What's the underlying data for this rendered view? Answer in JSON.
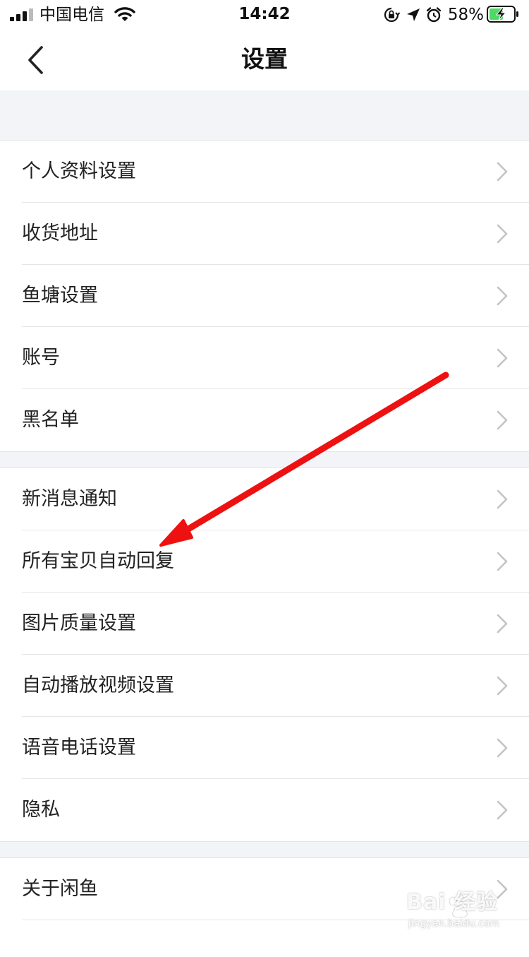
{
  "status_bar": {
    "carrier": "中国电信",
    "time": "14:42",
    "battery_percent": "58%",
    "battery_level": 0.58,
    "icons": [
      "signal-icon",
      "wifi-icon",
      "orientation-lock-icon",
      "location-icon",
      "alarm-icon",
      "battery-charging-icon"
    ]
  },
  "nav": {
    "title": "设置",
    "back_icon": "chevron-left-icon"
  },
  "groups": [
    {
      "items": [
        {
          "label": "个人资料设置"
        },
        {
          "label": "收货地址"
        },
        {
          "label": "鱼塘设置"
        },
        {
          "label": "账号"
        },
        {
          "label": "黑名单"
        }
      ]
    },
    {
      "items": [
        {
          "label": "新消息通知"
        },
        {
          "label": "所有宝贝自动回复"
        },
        {
          "label": "图片质量设置"
        },
        {
          "label": "自动播放视频设置"
        },
        {
          "label": "语音电话设置"
        },
        {
          "label": "隐私"
        }
      ]
    },
    {
      "items": [
        {
          "label": "关于闲鱼"
        }
      ]
    }
  ],
  "annotation": {
    "arrow_color": "#ee1111",
    "points_to": "所有宝贝自动回复"
  },
  "watermark": {
    "brand": "Bai 经验",
    "url": "jingyan.baidu.com"
  },
  "colors": {
    "background": "#f3f4f8",
    "surface": "#ffffff",
    "text": "#222222",
    "chevron": "#c4c4c8"
  }
}
